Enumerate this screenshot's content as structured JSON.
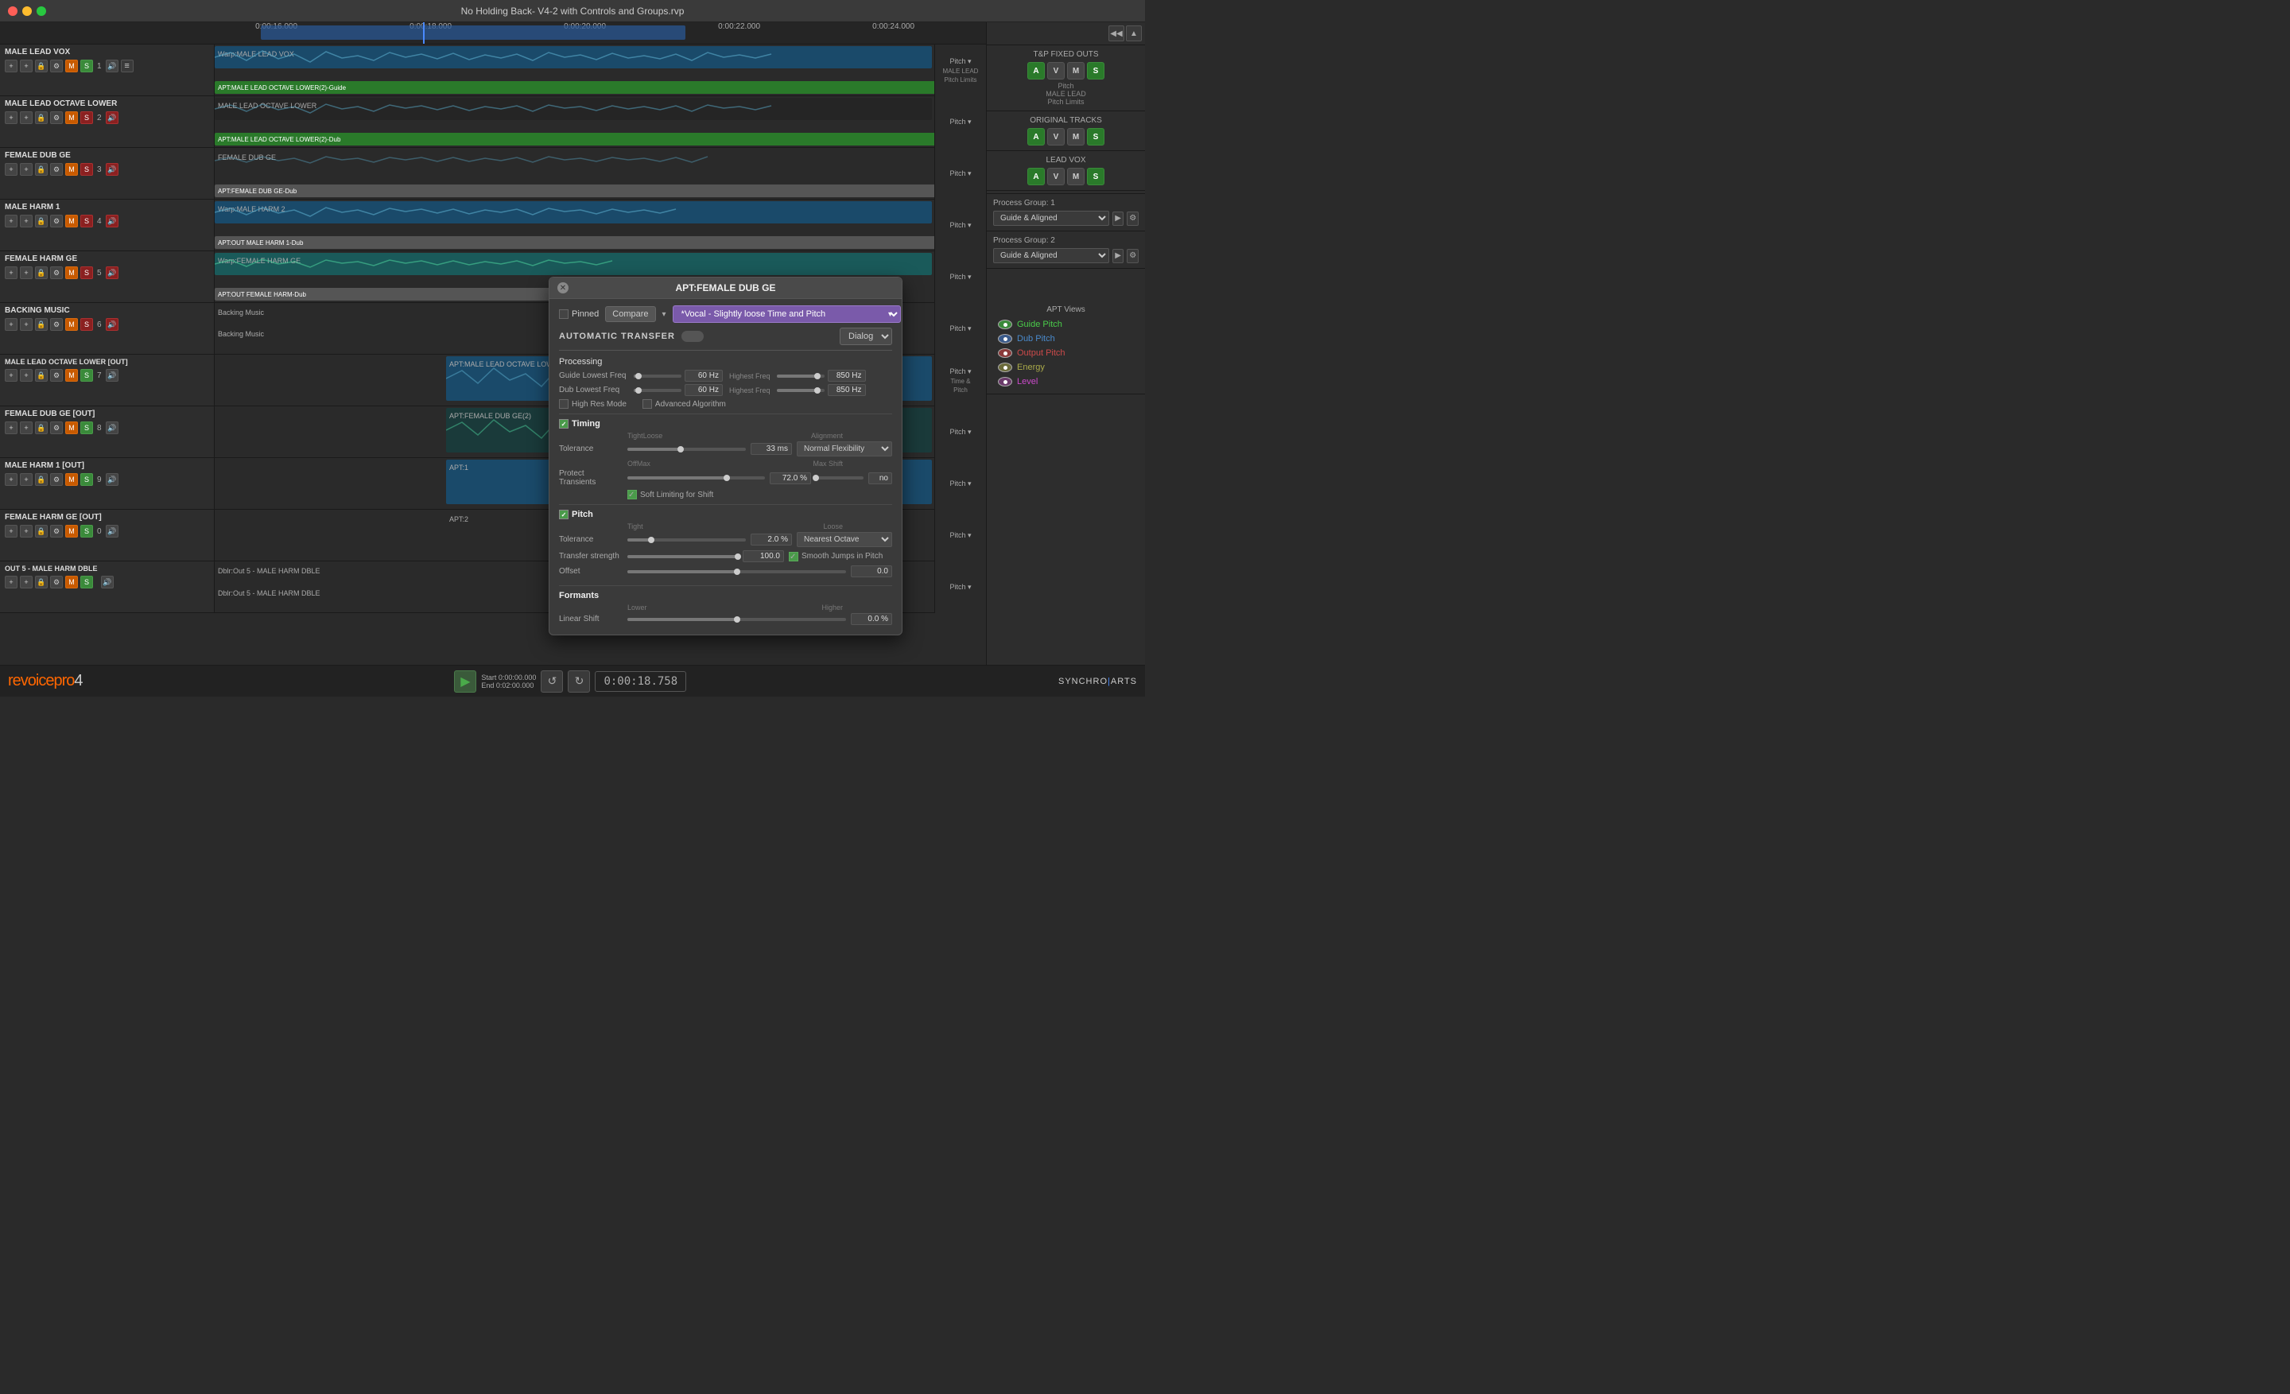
{
  "titlebar": {
    "title": "No Holding Back- V4-2 with Controls and Groups.rvp"
  },
  "tracks": [
    {
      "id": "track1",
      "name": "MALE LEAD VOX",
      "number": "1",
      "has_s": true,
      "s_color": "green",
      "waveform_label": "Warp:MALE LEAD VOX",
      "apt_label": "APT:MALE LEAD OCTAVE LOWER(2)-Guide",
      "apt_color": "green"
    },
    {
      "id": "track2",
      "name": "MALE LEAD OCTAVE LOWER",
      "number": "2",
      "has_s": true,
      "s_color": "orange",
      "waveform_label": "MALE LEAD OCTAVE LOWER",
      "apt_label": "APT:MALE LEAD OCTAVE LOWER(2)-Dub",
      "apt_color": "green"
    },
    {
      "id": "track3",
      "name": "FEMALE DUB GE",
      "number": "3",
      "has_s": true,
      "s_color": "orange",
      "waveform_label": "FEMALE DUB GE",
      "apt_label": "APT:FEMALE DUB GE-Dub",
      "apt_color": "gray"
    },
    {
      "id": "track4",
      "name": "MALE HARM 1",
      "number": "4",
      "has_s": true,
      "s_color": "orange",
      "waveform_label": "Warp:MALE HARM 2",
      "apt_label": "APT:OUT MALE HARM 1-Dub",
      "apt_color": "gray"
    },
    {
      "id": "track5",
      "name": "FEMALE HARM GE",
      "number": "5",
      "has_s": true,
      "s_color": "orange",
      "waveform_label": "Warp:FEMALE HARM GE",
      "apt_label": "APT:OUT FEMALE HARM-Dub",
      "apt_color": "gray"
    },
    {
      "id": "track6",
      "name": "Backing Music",
      "number": "6",
      "has_s": true,
      "s_color": "orange",
      "waveform_label": "Backing Music",
      "apt_label": "",
      "apt_color": ""
    },
    {
      "id": "track7",
      "name": "MALE LEAD OCTAVE LOWER [OUT]",
      "number": "7",
      "has_s": true,
      "s_color": "green",
      "waveform_label": "APT:MALE LEAD OCTAVE LOWER(2)",
      "apt_label": "",
      "apt_color": ""
    },
    {
      "id": "track8",
      "name": "FEMALE DUB GE [OUT]",
      "number": "8",
      "has_s": true,
      "s_color": "green",
      "waveform_label": "APT:FEMALE DUB GE(2)",
      "apt_label": "",
      "apt_color": ""
    },
    {
      "id": "track9",
      "name": "MALE HARM 1 [OUT]",
      "number": "9",
      "has_s": true,
      "s_color": "green",
      "waveform_label": "APT:1",
      "apt_label": "",
      "apt_color": ""
    },
    {
      "id": "track10",
      "name": "FEMALE HARM GE [OUT]",
      "number": "0",
      "has_s": true,
      "s_color": "green",
      "waveform_label": "APT:2",
      "apt_label": "",
      "apt_color": ""
    },
    {
      "id": "track11",
      "name": "Out 5 - MALE HARM DBLE",
      "number": "",
      "has_s": true,
      "s_color": "green",
      "waveform_label": "Dblr:Out 5 - MALE HARM DBLE",
      "apt_label": "Dblr:Out 5 - MALE HARM DBLE",
      "apt_color": ""
    }
  ],
  "timeline": {
    "markers": [
      "0:00:16.000",
      "0:00:18.000",
      "0:00:20.000",
      "0:00:22.000",
      "0:00:24.000"
    ],
    "playhead_time": "0:00:18.758"
  },
  "modal": {
    "title": "APT:FEMALE DUB GE",
    "pinned_label": "Pinned",
    "compare_label": "Compare",
    "preset": "*Vocal - Slightly loose Time and Pitch",
    "auto_transfer_label": "AUTOMATIC TRANSFER",
    "dialog_label": "Dialog",
    "processing": {
      "title": "Processing",
      "guide_lowest_freq_label": "Guide Lowest Freq",
      "guide_lowest_freq_value": "60 Hz",
      "guide_highest_freq_label": "Highest Freq",
      "guide_highest_freq_value": "850 Hz",
      "dub_lowest_freq_label": "Dub Lowest Freq",
      "dub_lowest_freq_value": "60 Hz",
      "dub_highest_freq_label": "Highest Freq",
      "dub_highest_freq_value": "850 Hz",
      "high_res_mode_label": "High Res Mode",
      "advanced_algorithm_label": "Advanced Algorithm"
    },
    "timing": {
      "title": "Timing",
      "tolerance_label": "Tolerance",
      "tolerance_value": "33 ms",
      "alignment_label": "Alignment",
      "alignment_value": "Normal Flexibility",
      "protect_transients_label": "Protect Transients",
      "protect_transients_value": "72.0 %",
      "max_shift_label": "Max Shift",
      "max_shift_value": "no",
      "soft_limiting_label": "Soft Limiting for Shift"
    },
    "pitch": {
      "title": "Pitch",
      "tolerance_label": "Tolerance",
      "tolerance_value": "2.0 %",
      "alignment_label": "Nearest Octave",
      "transfer_strength_label": "Transfer strength",
      "transfer_strength_value": "100.0",
      "smooth_jumps_label": "Smooth Jumps in Pitch",
      "offset_label": "Offset",
      "offset_value": "0.0"
    },
    "formants": {
      "title": "Formants",
      "linear_shift_label": "Linear Shift",
      "linear_shift_value": "0.0 %"
    }
  },
  "right_panel": {
    "tp_fixed_outs_title": "T&P FIXED OUTS",
    "original_tracks_title": "ORIGINAL TRACKS",
    "lead_vox_title": "LEAD VOX",
    "tp_buttons": [
      "A",
      "V",
      "M",
      "S"
    ],
    "ot_buttons": [
      "A",
      "V",
      "M",
      "S"
    ],
    "lv_buttons": [
      "A",
      "V",
      "M",
      "S"
    ],
    "pitch_male_lead": "Pitch",
    "pitch_male_lead_sub": "MALE LEAD",
    "pitch_limits": "Pitch Limits",
    "process_group_1_title": "Process Group: 1",
    "process_group_1_value": "Guide & Aligned",
    "process_group_2_title": "Process Group: 2",
    "process_group_2_value": "Guide & Aligned",
    "apt_views_title": "APT Views",
    "apt_views": [
      {
        "label": "Guide Pitch",
        "active": true
      },
      {
        "label": "Dub Pitch",
        "active": true
      },
      {
        "label": "Output Pitch",
        "active": true
      },
      {
        "label": "Energy",
        "active": true
      },
      {
        "label": "Level",
        "active": true
      }
    ]
  },
  "bottom_bar": {
    "start_label": "Start",
    "start_value": "0:00:00.000",
    "end_label": "End",
    "end_value": "0:02:00.000",
    "time_display": "0:00:18.758",
    "logo_orange": "revoicepro",
    "logo_gray": "4",
    "synchro_arts": "SYNCHRO ARTS"
  }
}
